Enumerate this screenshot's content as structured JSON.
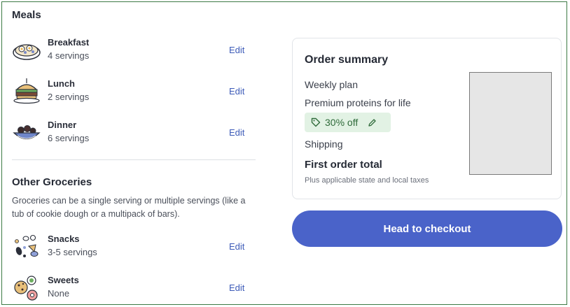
{
  "meals": {
    "title": "Meals",
    "items": [
      {
        "name": "Breakfast",
        "servings": "4 servings",
        "edit": "Edit",
        "icon": "breakfast-bowl-icon"
      },
      {
        "name": "Lunch",
        "servings": "2 servings",
        "edit": "Edit",
        "icon": "sandwich-icon"
      },
      {
        "name": "Dinner",
        "servings": "6 servings",
        "edit": "Edit",
        "icon": "dinner-bowl-icon"
      }
    ]
  },
  "groceries": {
    "title": "Other Groceries",
    "description": "Groceries can be a single serving or multiple servings (like a tub of cookie dough or a multipack of bars).",
    "items": [
      {
        "name": "Snacks",
        "servings": "3-5 servings",
        "edit": "Edit",
        "icon": "snacks-icon"
      },
      {
        "name": "Sweets",
        "servings": "None",
        "edit": "Edit",
        "icon": "sweets-icon"
      }
    ]
  },
  "summary": {
    "title": "Order summary",
    "weekly_plan": "Weekly plan",
    "premium": "Premium proteins for life",
    "discount": "30% off",
    "shipping": "Shipping",
    "first_order_total": "First order total",
    "taxes_note": "Plus applicable state and local taxes"
  },
  "checkout_button": "Head to checkout",
  "colors": {
    "accent": "#4a63c9",
    "link": "#3d5bb8",
    "discount_bg": "#e2f2e4",
    "discount_text": "#2f6b3a"
  }
}
